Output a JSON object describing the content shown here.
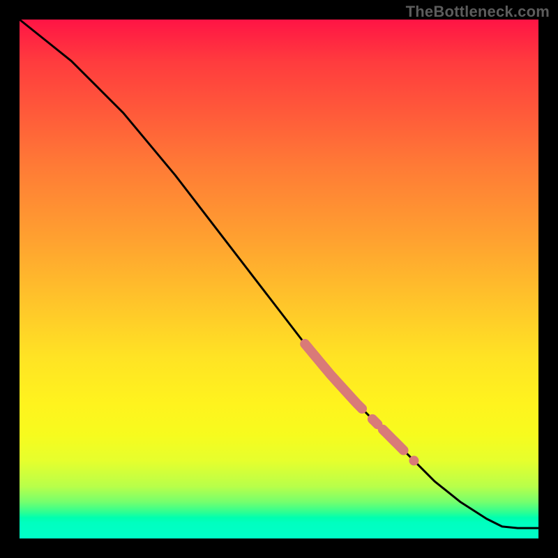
{
  "watermark": "TheBottleneck.com",
  "colors": {
    "curve": "#000000",
    "marker": "#d97a78",
    "gradient_top": "#ff1445",
    "gradient_mid": "#ffe324",
    "gradient_bottom": "#00ffc8"
  },
  "chart_data": {
    "type": "line",
    "title": "",
    "xlabel": "",
    "ylabel": "",
    "xlim": [
      0,
      100
    ],
    "ylim": [
      0,
      100
    ],
    "grid": false,
    "series": [
      {
        "name": "curve",
        "x": [
          0,
          5,
          10,
          15,
          20,
          25,
          30,
          35,
          40,
          45,
          50,
          55,
          60,
          65,
          70,
          75,
          80,
          85,
          90,
          93,
          96,
          100
        ],
        "y": [
          100,
          96,
          92,
          87,
          82,
          76,
          70,
          63.5,
          57,
          50.5,
          44,
          37.5,
          31.5,
          26,
          21,
          16,
          11,
          7,
          3.8,
          2.3,
          2.0,
          2.0
        ]
      }
    ],
    "marker_segments": [
      {
        "x_start": 55,
        "x_end": 66
      },
      {
        "x_start": 68,
        "x_end": 69
      },
      {
        "x_start": 70,
        "x_end": 74
      }
    ],
    "marker_dots": [
      {
        "x": 76
      }
    ]
  }
}
